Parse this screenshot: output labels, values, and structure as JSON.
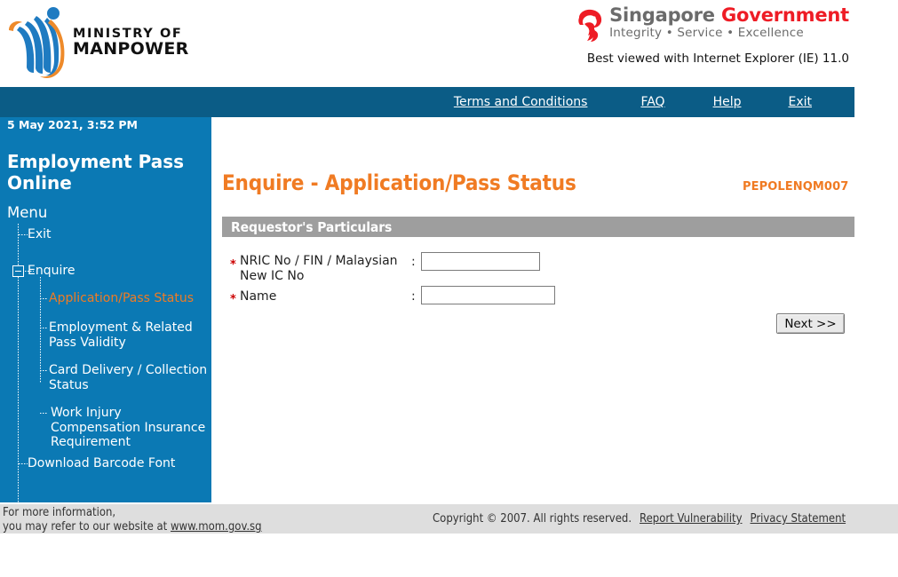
{
  "header": {
    "mom_logo_line1": "MINISTRY OF",
    "mom_logo_line2": "MANPOWER",
    "sg_title_grey": "Singapore ",
    "sg_title_red": "Government",
    "sg_subtitle": "Integrity • Service • Excellence",
    "best_viewed": "Best viewed with Internet Explorer (IE) 11.0",
    "colors": {
      "mom_blue": "#1f7bc1",
      "mom_orange": "#ee8a2a",
      "sg_red": "#ee1c25",
      "sg_grey": "#6b6b6b"
    }
  },
  "navbar": {
    "links": [
      {
        "label": "Terms and Conditions"
      },
      {
        "label": "FAQ"
      },
      {
        "label": "Help"
      },
      {
        "label": "Exit"
      }
    ],
    "background": "#0b5c86"
  },
  "sidebar": {
    "datetime": "5 May 2021, 3:52 PM",
    "app_title": "Employment Pass Online",
    "menu_label": "Menu",
    "background": "#0b79b4",
    "active_color": "#f07b23",
    "items": [
      {
        "label": "Exit",
        "level": 1,
        "active": false
      },
      {
        "label": "Enquire",
        "level": 1,
        "active": false,
        "expandable": true,
        "expanded": true
      },
      {
        "label": "Application/Pass Status",
        "level": 2,
        "active": true
      },
      {
        "label": "Employment & Related Pass Validity",
        "level": 2,
        "active": false
      },
      {
        "label": "Card Delivery / Collection Status",
        "level": 2,
        "active": false
      },
      {
        "label": "Work Injury Compensation Insurance Requirement",
        "level": 2,
        "active": false
      },
      {
        "label": "Download Barcode Font",
        "level": 1,
        "active": false
      }
    ]
  },
  "main": {
    "page_title": "Enquire - Application/Pass Status",
    "page_code": "PEPOLENQM007",
    "section_title": "Requestor's Particulars",
    "section_bar_color": "#9e9e9e",
    "title_color": "#f07b23",
    "required_marker": "*",
    "colon": ":",
    "fields": [
      {
        "label": "NRIC No / FIN / Malaysian New IC No",
        "required": true,
        "value": "",
        "placeholder": ""
      },
      {
        "label": "Name",
        "required": true,
        "value": "",
        "placeholder": ""
      }
    ],
    "next_button": "Next >>"
  },
  "footer": {
    "left_line1": "For more information,",
    "left_line2_prefix": "you may refer to our website at ",
    "left_link": "www.mom.gov.sg",
    "copyright": "Copyright © 2007. All rights reserved.",
    "links": [
      {
        "label": "Report Vulnerability"
      },
      {
        "label": "Privacy Statement "
      }
    ],
    "background": "#dedede"
  }
}
